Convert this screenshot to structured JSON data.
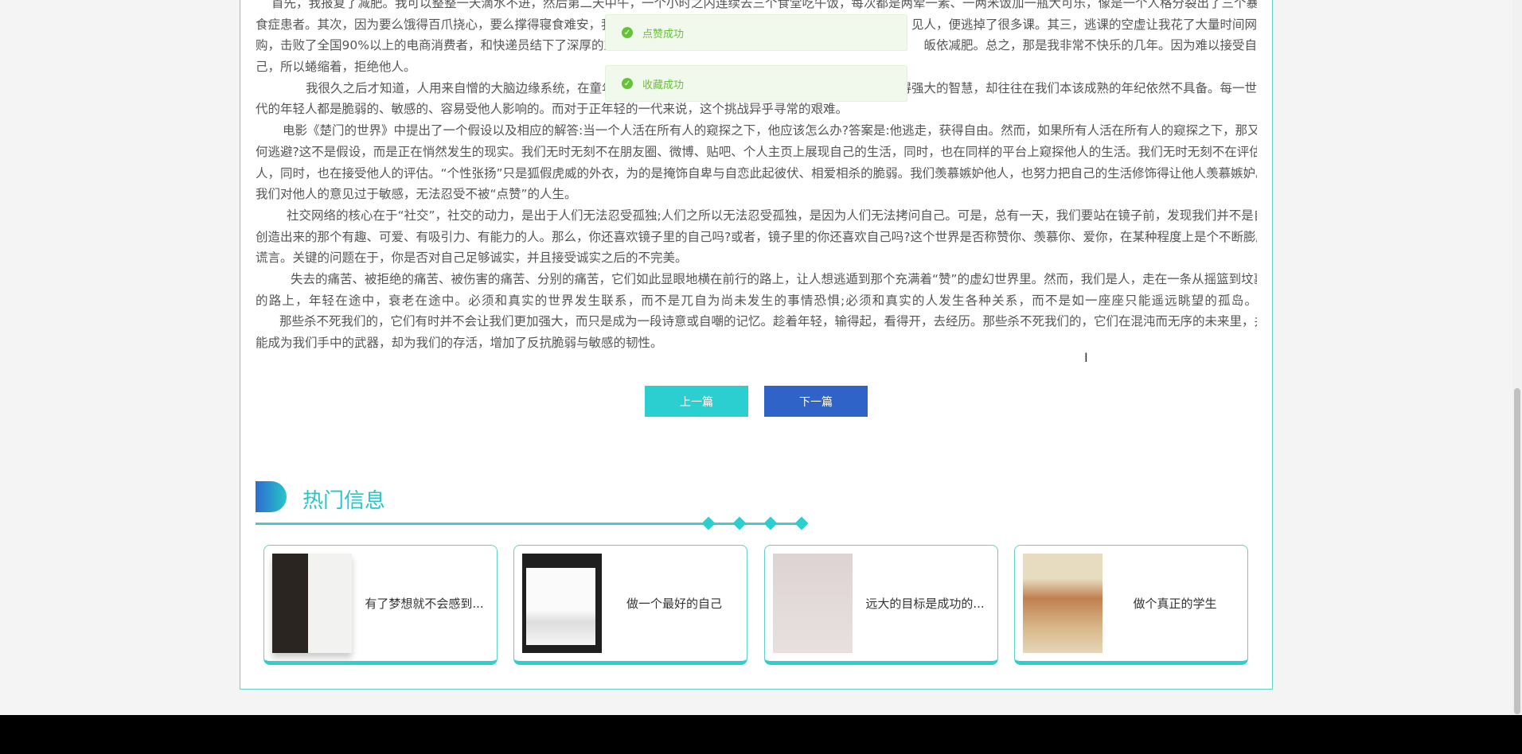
{
  "article": {
    "lines": [
      "首先，我报复了减肥。我可以整整一天滴水不进，然后第二天中午，一个小时之内连续去三个食堂吃午饭，每次都是两荤一素、一两米饭加一瓶大可乐，像是一个人格分裂出了三个暴",
      {
        "left": "食症患者。其次，因为要么饿得百爪挠心，要么撑得寝食难安，我",
        "right": "见人，便逃掉了很多课。其三，逃课的空虚让我花了大量时间网"
      },
      {
        "left": "购，击败了全国90%以上的电商消费者，和快递员结下了深厚的友谊",
        "right": "皈依减肥。总之，那是我非常不快乐的几年。因为难以接受自"
      },
      "己，所以蜷缩着，拒绝他人。",
      {
        "left": "我很久之后才知道，人用来自憎的大脑边缘系统，在童年时",
        "right": "得强大的智慧，却往往在我们本该成熟的年纪依然不具备。每一世"
      },
      "代的年轻人都是脆弱的、敏感的、容易受他人影响的。而对于正年轻的一代来说，这个挑战异乎寻常的艰难。",
      "电影《楚门的世界》中提出了一个假设以及相应的解答:当一个人活在所有人的窥探之下，他应该怎么办?答案是:他逃走，获得自由。然而，如果所有人活在所有人的窥探之下，那又该如",
      "何逃避?这不是假设，而是正在悄然发生的现实。我们无时无刻不在朋友圈、微博、贴吧、个人主页上展现自己的生活，同时，也在同样的平台上窥探他人的生活。我们无时无刻不在评估他",
      "人，同时，也在接受他人的评估。“个性张扬”只是狐假虎威的外衣，为的是掩饰自卑与自恋此起彼伏、相爱相杀的脆弱。我们羡慕嫉妒他人，也努力把自己的生活修饰得让他人羡慕嫉妒。",
      "我们对他人的意见过于敏感，无法忍受不被“点赞”的人生。",
      "社交网络的核心在于“社交”，社交的动力，是出于人们无法忍受孤独;人们之所以无法忍受孤独，是因为人们无法拷问自己。可是，总有一天，我们要站在镜子前，发现我们并不是自己",
      "创造出来的那个有趣、可爱、有吸引力、有能力的人。那么，你还喜欢镜子里的自己吗?或者，镜子里的你还喜欢自己吗?这个世界是否称赞你、羡慕你、爱你，在某种程度上是个不断膨胀的",
      "谎言。关键的问题在于，你是否对自己足够诚实，并且接受诚实之后的不完美。",
      "失去的痛苦、被拒绝的痛苦、被伤害的痛苦、分别的痛苦，它们如此显眼地横在前行的路上，让人想逃遁到那个充满着“赞”的虚幻世界里。然而，我们是人，走在一条从摇篮到坟墓",
      "的路上，年轻在途中，衰老在途中。必须和真实的世界发生联系，而不是兀自为尚未发生的事情恐惧;必须和真实的人发生各种关系，而不是如一座座只能遥远眺望的孤岛。",
      "那些杀不死我们的，它们有时并不会让我们更加强大，而只是成为一段诗意或自嘲的记忆。趁着年轻，输得起，看得开，去经历。那些杀不死我们的，它们在混沌而无序的未来里，并不",
      "能成为我们手中的武器，却为我们的存活，增加了反抗脆弱与敏感的韧性。"
    ]
  },
  "toasts": [
    {
      "text": "点赞成功",
      "icon": "check-circle-icon"
    },
    {
      "text": "收藏成功",
      "icon": "check-circle-icon"
    }
  ],
  "nav": {
    "prev": "上一篇",
    "next": "下一篇"
  },
  "hot": {
    "title": "热门信息",
    "cards": [
      {
        "title": "有了梦想就不会感到..."
      },
      {
        "title": "做一个最好的自己"
      },
      {
        "title": "远大的目标是成功的..."
      },
      {
        "title": "做个真正的学生"
      }
    ]
  },
  "colors": {
    "accent": "#2ccfcf",
    "next_button": "#2f63c8",
    "toast_text": "#67c23a",
    "toast_bg": "#f0f9eb"
  }
}
